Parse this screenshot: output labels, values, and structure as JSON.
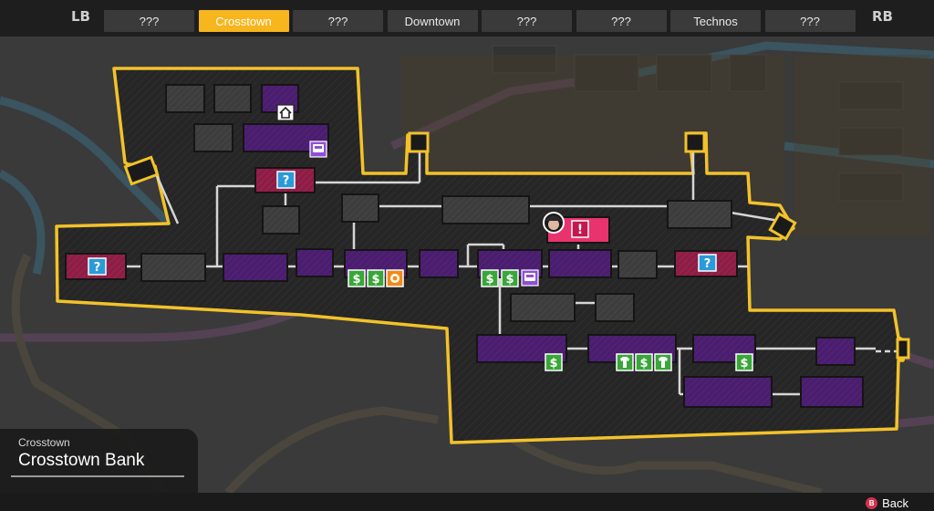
{
  "tabs": {
    "left_shoulder": "LB",
    "right_shoulder": "RB",
    "items": [
      "???",
      "Crosstown",
      "???",
      "Downtown",
      "???",
      "???",
      "Technos",
      "???"
    ],
    "active_label": "Crosstown"
  },
  "info": {
    "district": "Crosstown",
    "location": "Crosstown Bank"
  },
  "footer": {
    "button_glyph": "B",
    "back_label": "Back"
  },
  "colors": {
    "accent": "#f7b51e",
    "room_purple": "#4a1d6e",
    "room_gray": "#3d3d3d",
    "room_maroon": "#8e1d45",
    "money_green": "#3aa63a",
    "mystery_blue": "#2a9ad8",
    "alert_pink": "#e8336e"
  },
  "map": {
    "icons": {
      "home": "home-icon",
      "bus": "bus-icon",
      "mystery": "question-icon",
      "money": "dollar-icon",
      "food": "food-icon",
      "shop": "shirt-icon",
      "alert": "exclamation-icon",
      "player": "player-marker-icon"
    },
    "glyphs": {
      "mystery": "?",
      "money": "$",
      "alert": "!"
    }
  }
}
